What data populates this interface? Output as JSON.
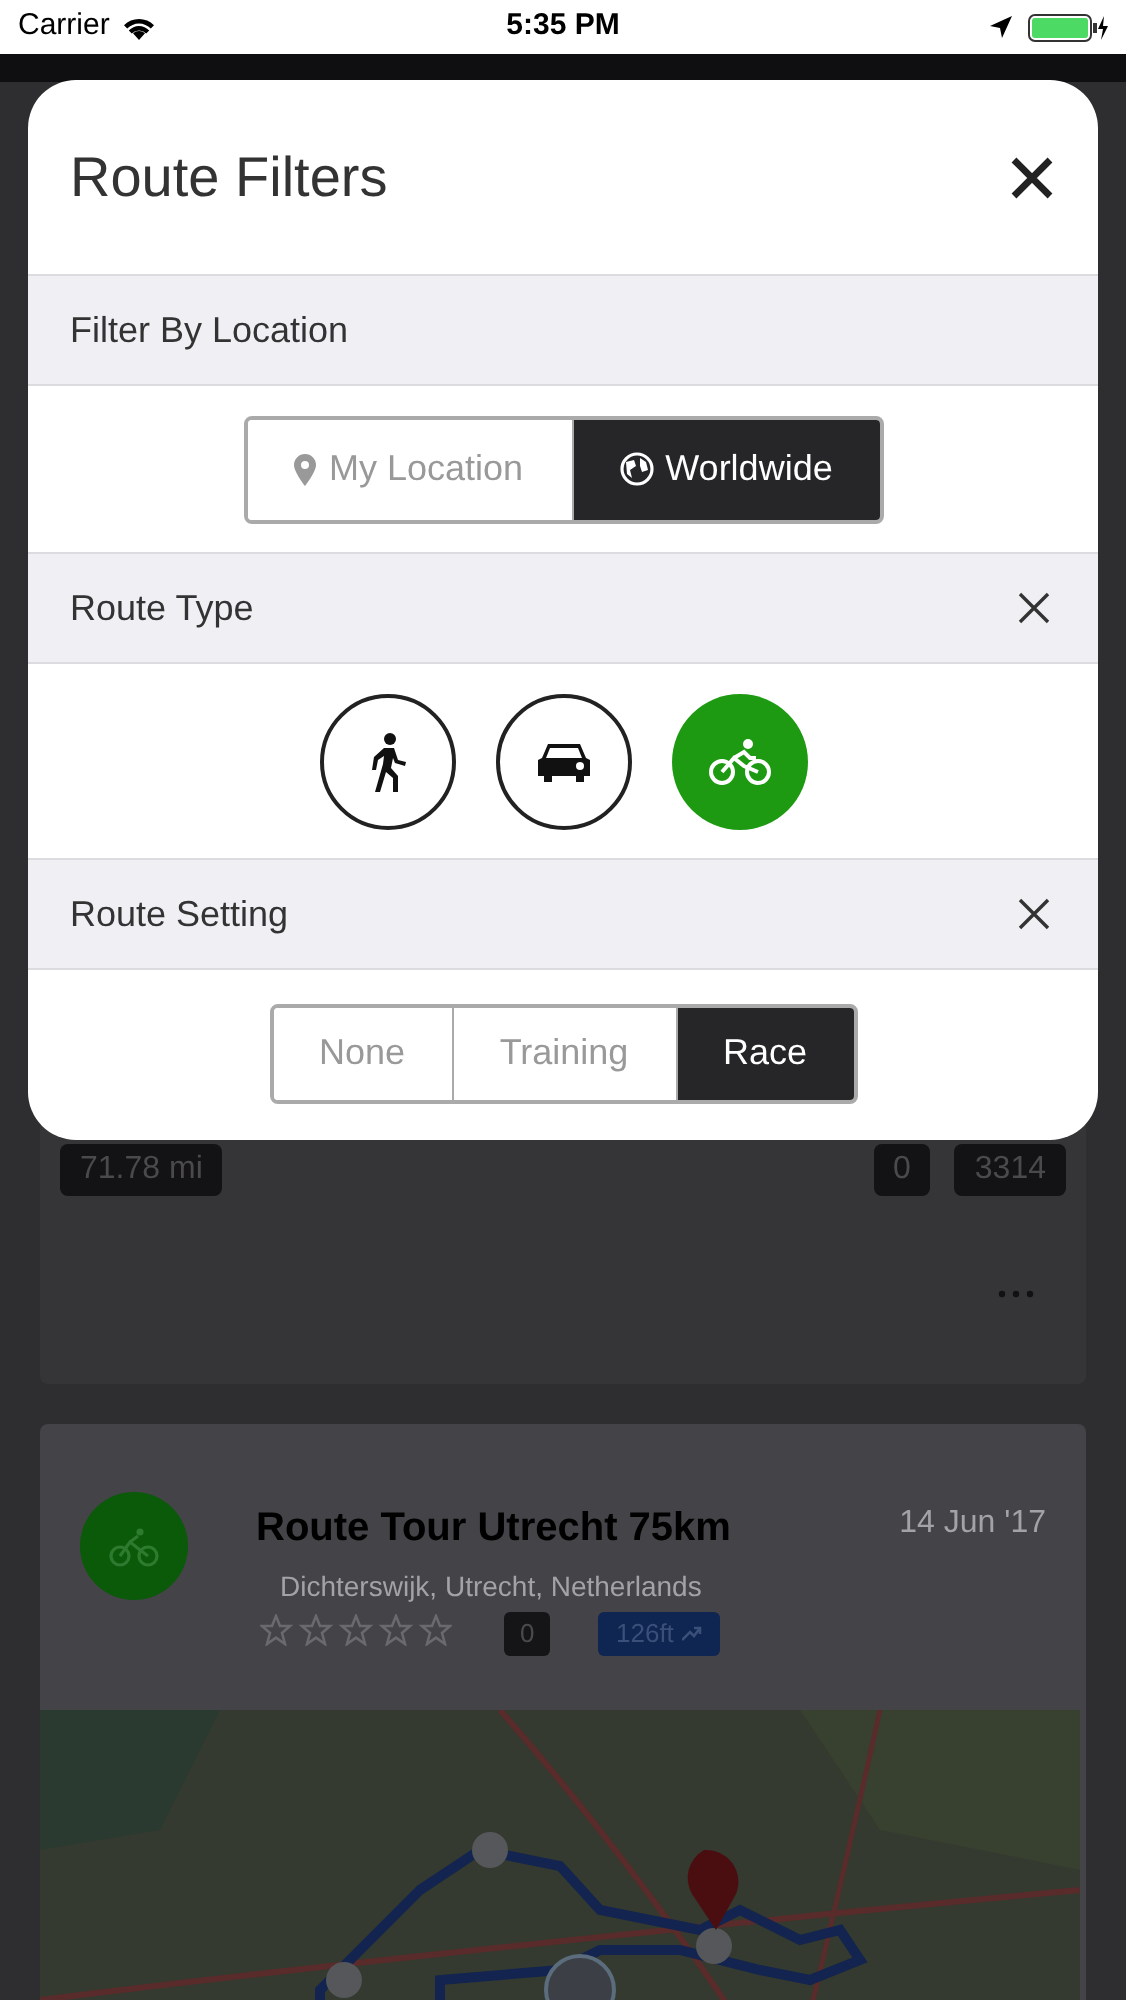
{
  "status_bar": {
    "carrier": "Carrier",
    "time": "5:35 PM"
  },
  "modal": {
    "title": "Route Filters",
    "sections": [
      {
        "title": "Filter By Location",
        "clearable": false,
        "kind": "segments",
        "options": [
          {
            "label": "My Location",
            "kind": "pin",
            "selected": false
          },
          {
            "label": "Worldwide",
            "kind": "globe",
            "selected": true
          }
        ]
      },
      {
        "title": "Route Type",
        "clearable": true,
        "kind": "circles",
        "options": [
          {
            "kind": "walk",
            "selected": false
          },
          {
            "kind": "car",
            "selected": false
          },
          {
            "kind": "bike",
            "selected": true
          }
        ]
      },
      {
        "title": "Route Setting",
        "clearable": true,
        "kind": "segments",
        "options": [
          {
            "label": "None",
            "kind": "text",
            "selected": false
          },
          {
            "label": "Training",
            "kind": "text",
            "selected": false
          },
          {
            "label": "Race",
            "kind": "text",
            "selected": true
          }
        ]
      }
    ]
  },
  "routes": [
    {
      "distance": "71.78 mi",
      "comments": "0",
      "views": "3314"
    },
    {
      "title": "Route Tour Utrecht 75km",
      "date": "14 Jun '17",
      "location": "Dichterswijk, Utrecht, Netherlands",
      "stars": 0,
      "rating_count": "0",
      "elevation": "126ft"
    }
  ]
}
